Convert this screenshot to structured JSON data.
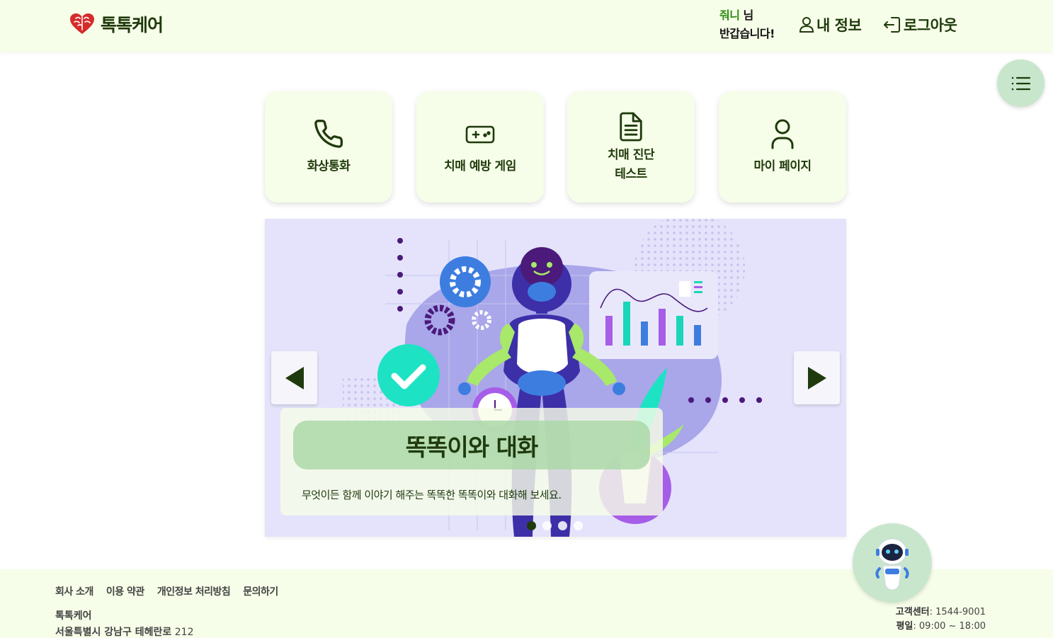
{
  "header": {
    "logo_text": "톡톡케어",
    "greeting_name": "줘니",
    "greeting_suffix": "님",
    "greeting_line2": "반갑습니다!",
    "my_info": "내 정보",
    "logout": "로그아웃"
  },
  "menu": {
    "cards": [
      {
        "label": "화상통화",
        "icon": "phone-icon"
      },
      {
        "label": "치매 예방 게임",
        "icon": "gamepad-icon"
      },
      {
        "label_line1": "치매 진단",
        "label_line2": "테스트",
        "icon": "document-icon"
      },
      {
        "label": "마이 페이지",
        "icon": "user-icon"
      }
    ]
  },
  "carousel": {
    "title": "똑똑이와 대화",
    "description": "무엇이든 함께 이야기 해주는 똑똑한 똑똑이와 대화해 보세요.",
    "slide_count": 4,
    "active_index": 0
  },
  "footer": {
    "links": [
      "회사 소개",
      "이용 약관",
      "개인정보 처리방침",
      "문의하기"
    ],
    "company": "톡톡케어",
    "address_label": "서울특별시 강남구 테헤란로",
    "address_number": "212",
    "contact_label": "고객센터",
    "contact_value": ": 1544-9001",
    "weekday_label": "평일",
    "weekday_value": ": 09:00 ~ 18:00"
  },
  "colors": {
    "header_bg": "#f6fde8",
    "text_dark_green": "#1f3a0c",
    "accent_green": "#2e8b12",
    "fab_bg": "#c8e6cc",
    "carousel_bg": "#e4e3fb"
  }
}
